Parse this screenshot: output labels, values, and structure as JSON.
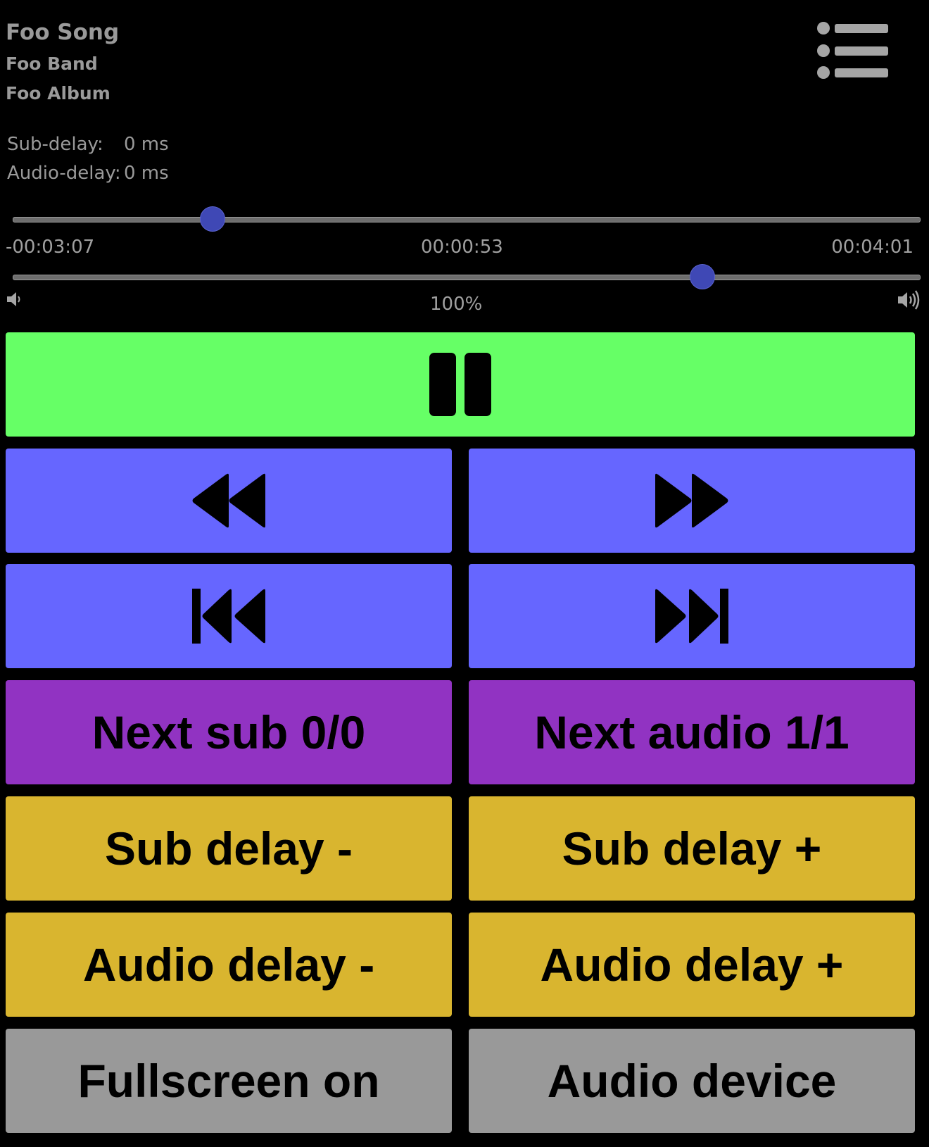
{
  "track": {
    "title": "Foo Song",
    "artist": "Foo Band",
    "album": "Foo Album"
  },
  "delays": {
    "sub_label": "Sub-delay:",
    "sub_value": "0 ms",
    "audio_label": "Audio-delay:",
    "audio_value": "0 ms"
  },
  "progress": {
    "remaining": "-00:03:07",
    "elapsed": "00:00:53",
    "duration": "00:04:01",
    "fraction": 0.22
  },
  "volume": {
    "label": "100%",
    "fraction": 0.76
  },
  "buttons": {
    "next_sub": "Next sub 0/0",
    "next_audio": "Next audio 1/1",
    "sub_delay_minus": "Sub delay -",
    "sub_delay_plus": "Sub delay +",
    "audio_delay_minus": "Audio delay -",
    "audio_delay_plus": "Audio delay +",
    "fullscreen": "Fullscreen on",
    "audio_device": "Audio device"
  },
  "colors": {
    "play_pause": "#66ff66",
    "seek": "#6666ff",
    "tracks": "#9133c2",
    "delay": "#d9b52f",
    "misc": "#999999"
  },
  "icons": {
    "menu": "list-menu-icon",
    "play_pause": "pause-icon",
    "rewind": "rewind-icon",
    "fast_forward": "fast-forward-icon",
    "previous": "skip-previous-icon",
    "next": "skip-next-icon",
    "volume_low": "volume-low-icon",
    "volume_high": "volume-high-icon"
  }
}
